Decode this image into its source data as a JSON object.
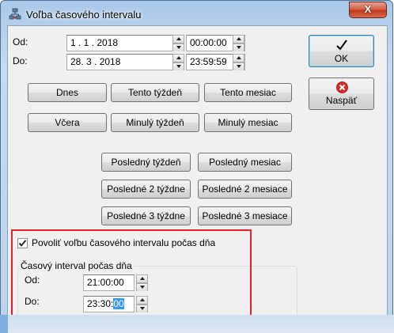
{
  "window": {
    "title": "Voľba časového intervalu",
    "close_label": "X"
  },
  "range": {
    "from_label": "Od:",
    "to_label": "Do:",
    "from_date": "1 . 1 . 2018",
    "from_time": "00:00:00",
    "to_date": "28. 3 . 2018",
    "to_time": "23:59:59"
  },
  "actions": {
    "ok_label": "OK",
    "back_label": "Naspäť"
  },
  "presets": {
    "today": "Dnes",
    "this_week": "Tento týždeň",
    "this_month": "Tento mesiac",
    "yesterday": "Včera",
    "last_week": "Minulý týždeň",
    "last_month": "Minulý mesiac",
    "latest_week": "Posledný týždeň",
    "latest_month": "Posledný mesiac",
    "latest_2_weeks": "Posledné 2 týždne",
    "latest_2_months": "Posledné 2 mesiace",
    "latest_3_weeks": "Posledné 3 týždne",
    "latest_3_months": "Posledné 3 mesiace"
  },
  "daytime": {
    "checkbox_label": "Povoliť voľbu časového intervalu počas dňa",
    "checked": true,
    "group_title": "Časový interval počas dňa",
    "from_label": "Od:",
    "to_label": "Do:",
    "from_time": "21:00:00",
    "to_time_prefix": "23:30:",
    "to_time_selected": "00"
  },
  "colors": {
    "highlight": "#e8202a",
    "selection": "#3399ff",
    "close_button": "#c1391c"
  }
}
